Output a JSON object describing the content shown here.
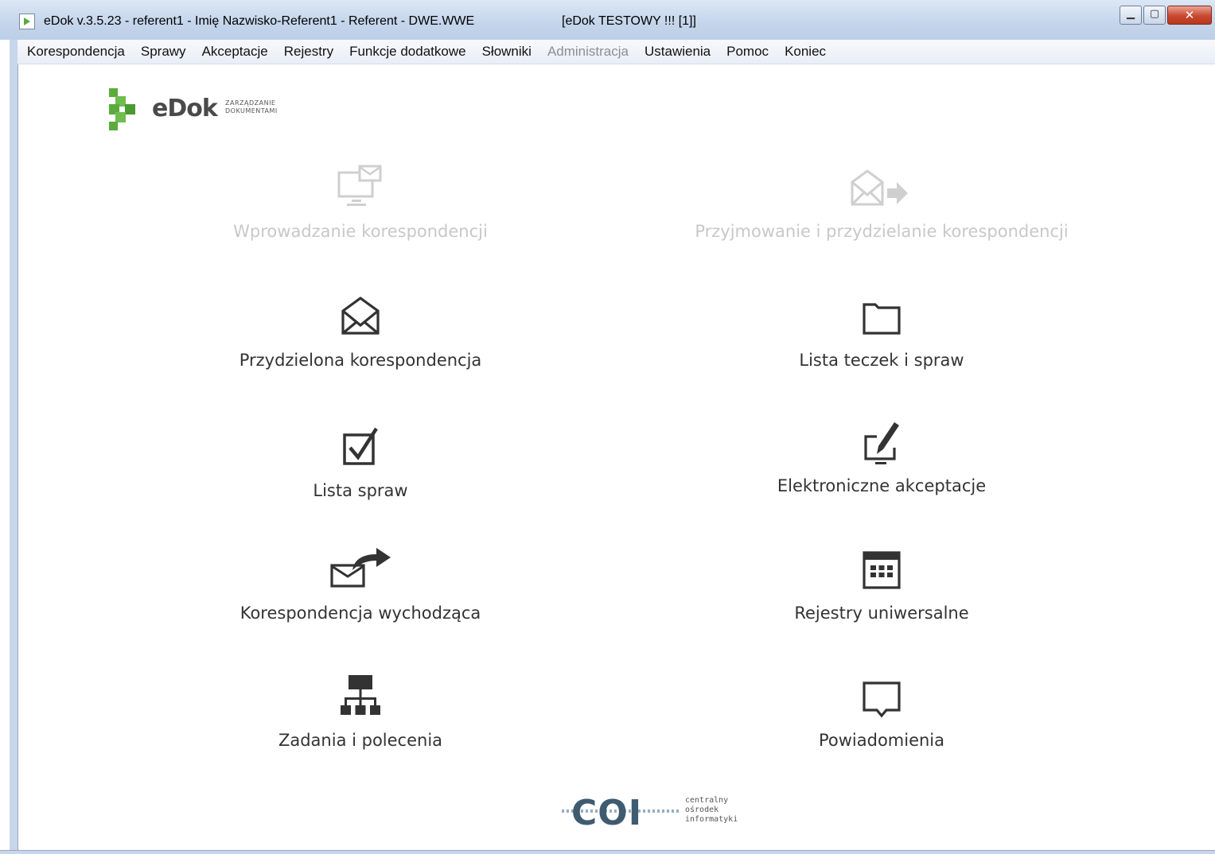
{
  "window": {
    "title": "eDok v.3.5.23 - referent1 - Imię Nazwisko-Referent1 - Referent - DWE.WWE",
    "title_extra": "[eDok TESTOWY !!! [1]]"
  },
  "menu": [
    {
      "label": "Korespondencja",
      "enabled": true
    },
    {
      "label": "Sprawy",
      "enabled": true
    },
    {
      "label": "Akceptacje",
      "enabled": true
    },
    {
      "label": "Rejestry",
      "enabled": true
    },
    {
      "label": "Funkcje dodatkowe",
      "enabled": true
    },
    {
      "label": "Słowniki",
      "enabled": true
    },
    {
      "label": "Administracja",
      "enabled": false
    },
    {
      "label": "Ustawienia",
      "enabled": true
    },
    {
      "label": "Pomoc",
      "enabled": true
    },
    {
      "label": "Koniec",
      "enabled": true
    }
  ],
  "logo": {
    "word": "eDok",
    "subtitle_line1": "ZARZĄDZANIE",
    "subtitle_line2": "DOKUMENTAMI",
    "brand_color": "#5aab3c"
  },
  "tiles": [
    {
      "label": "Wprowadzanie korespondencji",
      "icon": "monitor-mail-icon",
      "enabled": false
    },
    {
      "label": "Przyjmowanie i przydzielanie korespondencji",
      "icon": "envelope-forward-icon",
      "enabled": false
    },
    {
      "label": "Przydzielona korespondencja",
      "icon": "envelope-open-icon",
      "enabled": true
    },
    {
      "label": "Lista teczek i spraw",
      "icon": "folder-icon",
      "enabled": true
    },
    {
      "label": "Lista spraw",
      "icon": "checkbox-icon",
      "enabled": true
    },
    {
      "label": "Elektroniczne akceptacje",
      "icon": "pen-monitor-icon",
      "enabled": true
    },
    {
      "label": "Korespondencja wychodząca",
      "icon": "envelope-send-icon",
      "enabled": true
    },
    {
      "label": "Rejestry uniwersalne",
      "icon": "calendar-grid-icon",
      "enabled": true
    },
    {
      "label": "Zadania i polecenia",
      "icon": "org-chart-icon",
      "enabled": true
    },
    {
      "label": "Powiadomienia",
      "icon": "speech-bubble-icon",
      "enabled": true
    }
  ],
  "footer": {
    "word": "COI",
    "sub_line1": "centralny",
    "sub_line2": "ośrodek",
    "sub_line3": "informatyki",
    "color": "#3f5b70"
  }
}
